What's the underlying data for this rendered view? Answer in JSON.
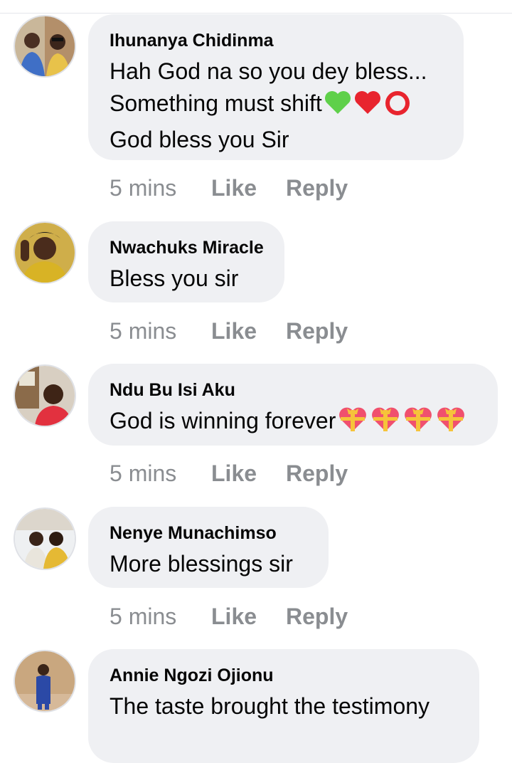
{
  "comments": [
    {
      "author": "Ihunanya Chidinma",
      "lines": [
        "Hah God na so you dey bless...",
        "Something must shift",
        "God bless you Sir"
      ],
      "emojis": [
        "green-heart-icon",
        "red-heart-icon",
        "hollow-red-circle-icon"
      ],
      "time": "5 mins",
      "like": "Like",
      "reply": "Reply"
    },
    {
      "author": "Nwachuks Miracle",
      "lines": [
        "Bless you sir"
      ],
      "time": "5 mins",
      "like": "Like",
      "reply": "Reply"
    },
    {
      "author": "Ndu Bu Isi Aku",
      "lines": [
        "God is winning forever"
      ],
      "emojis": [
        "gift-heart-icon",
        "gift-heart-icon",
        "gift-heart-icon",
        "gift-heart-icon"
      ],
      "time": "5 mins",
      "like": "Like",
      "reply": "Reply"
    },
    {
      "author": "Nenye Munachimso",
      "lines": [
        "More blessings sir"
      ],
      "time": "5 mins",
      "like": "Like",
      "reply": "Reply"
    },
    {
      "author": "Annie Ngozi Ojionu",
      "lines": [
        "The taste brought the testimony"
      ]
    }
  ],
  "colors": {
    "bubble": "#eff0f3",
    "meta_text": "#8a8d91",
    "text": "#050505"
  }
}
